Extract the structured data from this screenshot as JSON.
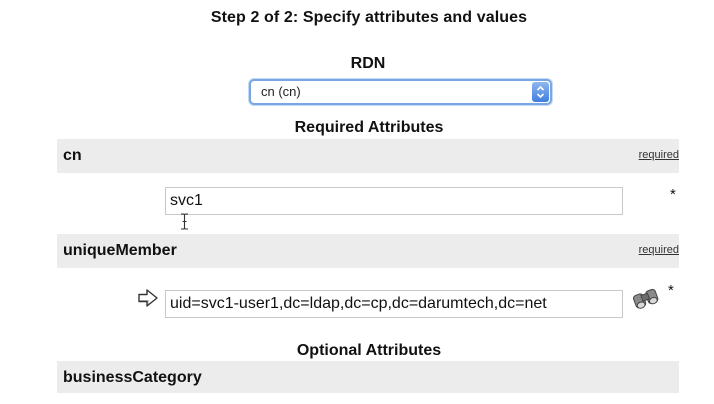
{
  "header": {
    "step_title": "Step 2 of 2: Specify attributes and values"
  },
  "rdn": {
    "heading": "RDN",
    "selected": "cn (cn)"
  },
  "required_section": {
    "heading": "Required Attributes",
    "attributes": [
      {
        "name": "cn",
        "flag": "required",
        "value": "svc1",
        "marker": "*"
      },
      {
        "name": "uniqueMember",
        "flag": "required",
        "value": "uid=svc1-user1,dc=ldap,dc=cp,dc=darumtech,dc=net",
        "marker": "*"
      }
    ]
  },
  "optional_section": {
    "heading": "Optional Attributes",
    "attributes": [
      {
        "name": "businessCategory"
      }
    ]
  },
  "icons": {
    "stepper": "up-down-chevron-icon",
    "text_cursor": "i-beam-cursor-icon",
    "value_pointer": "right-arrow-icon",
    "lookup": "binoculars-search-icon"
  },
  "colors": {
    "band": "#ececec",
    "select_focus": "#79a7e3",
    "stepper": "#3f7fe0"
  }
}
